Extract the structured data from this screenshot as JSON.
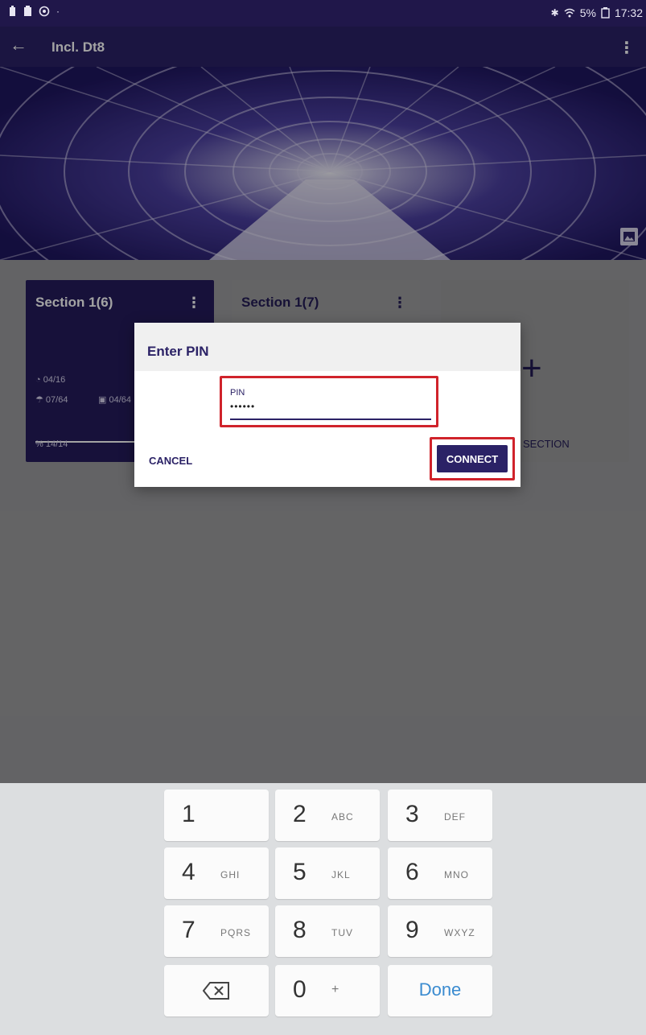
{
  "status_bar": {
    "left_icons": [
      "battery-saver-icon",
      "clipboard-icon",
      "camera-icon",
      "dot-icon"
    ],
    "battery": "5%",
    "time": "17:32"
  },
  "app_bar": {
    "title": "Incl. Dt8"
  },
  "sections": [
    {
      "title": "Section 1(6)",
      "stats": [
        "04/16",
        "07/64",
        "04/64",
        "14/14"
      ]
    },
    {
      "title": "Section 1(7)"
    }
  ],
  "add_section": {
    "label": "SECTION"
  },
  "dialog": {
    "title": "Enter PIN",
    "pin_label": "PIN",
    "pin_value": "••••••",
    "cancel_label": "CANCEL",
    "connect_label": "CONNECT"
  },
  "keyboard": {
    "rows": [
      [
        {
          "num": "1",
          "letters": ""
        },
        {
          "num": "2",
          "letters": "ABC"
        },
        {
          "num": "3",
          "letters": "DEF"
        }
      ],
      [
        {
          "num": "4",
          "letters": "GHI"
        },
        {
          "num": "5",
          "letters": "JKL"
        },
        {
          "num": "6",
          "letters": "MNO"
        }
      ],
      [
        {
          "num": "7",
          "letters": "PQRS"
        },
        {
          "num": "8",
          "letters": "TUV"
        },
        {
          "num": "9",
          "letters": "WXYZ"
        }
      ]
    ],
    "zero": {
      "num": "0",
      "letters": "+"
    },
    "done_label": "Done"
  },
  "colors": {
    "primary": "#2b2266",
    "highlight": "#d0232b",
    "done": "#3a8bd0"
  }
}
